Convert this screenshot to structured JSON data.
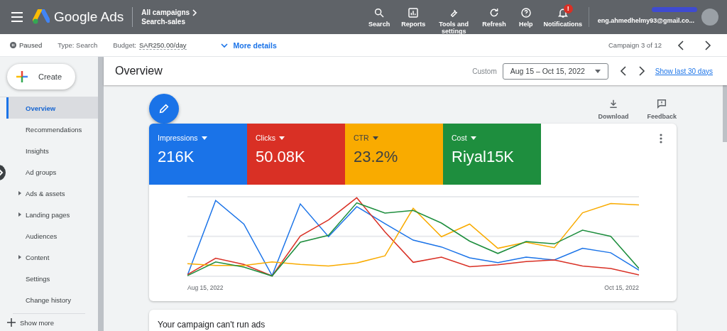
{
  "topbar": {
    "app_name": "Google Ads",
    "breadcrumb": {
      "parent": "All campaigns",
      "current": "Search-sales"
    },
    "actions": [
      {
        "label": "Search",
        "kind": "search"
      },
      {
        "label": "Reports",
        "kind": "reports"
      },
      {
        "label": "Tools and settings",
        "kind": "tools"
      },
      {
        "label": "Refresh",
        "kind": "refresh"
      },
      {
        "label": "Help",
        "kind": "help"
      },
      {
        "label": "Notifications",
        "kind": "notifications",
        "badge": "!"
      }
    ],
    "account": {
      "email": "eng.ahmedhelmy93@gmail.co..."
    }
  },
  "campaign_bar": {
    "status": "Paused",
    "type": "Type: Search",
    "budget_label": "Budget:",
    "budget_value": "SAR250.00/day",
    "more_details": "More details",
    "position": "Campaign 3 of 12"
  },
  "create_button": "Create",
  "sidebar": {
    "items": [
      {
        "label": "Overview",
        "selected": true,
        "expandable": false
      },
      {
        "label": "Recommendations",
        "selected": false,
        "expandable": false
      },
      {
        "label": "Insights",
        "selected": false,
        "expandable": false
      },
      {
        "label": "Ad groups",
        "selected": false,
        "expandable": false
      },
      {
        "label": "Ads & assets",
        "selected": false,
        "expandable": true
      },
      {
        "label": "Landing pages",
        "selected": false,
        "expandable": true
      },
      {
        "label": "Audiences",
        "selected": false,
        "expandable": false
      },
      {
        "label": "Content",
        "selected": false,
        "expandable": true
      },
      {
        "label": "Settings",
        "selected": false,
        "expandable": false
      },
      {
        "label": "Change history",
        "selected": false,
        "expandable": false
      }
    ],
    "show_more": "Show more"
  },
  "overview": {
    "title": "Overview",
    "range_label": "Custom",
    "date_range": "Aug 15 – Oct 15, 2022",
    "last_30": "Show last 30 days"
  },
  "tools": [
    {
      "label": "Download",
      "kind": "download"
    },
    {
      "label": "Feedback",
      "kind": "feedback"
    }
  ],
  "metrics": [
    {
      "label": "Impressions",
      "value": "216K",
      "color": "#1a73e8"
    },
    {
      "label": "Clicks",
      "value": "50.08K",
      "color": "#d93025"
    },
    {
      "label": "CTR",
      "value": "23.2%",
      "color": "#f9ab00"
    },
    {
      "label": "Cost",
      "value": "Riyal15K",
      "color": "#1e8e3e"
    }
  ],
  "chart": {
    "x_start": "Aug 15, 2022",
    "x_end": "Oct 15, 2022"
  },
  "notice": {
    "title": "Your campaign can't run ads"
  }
}
